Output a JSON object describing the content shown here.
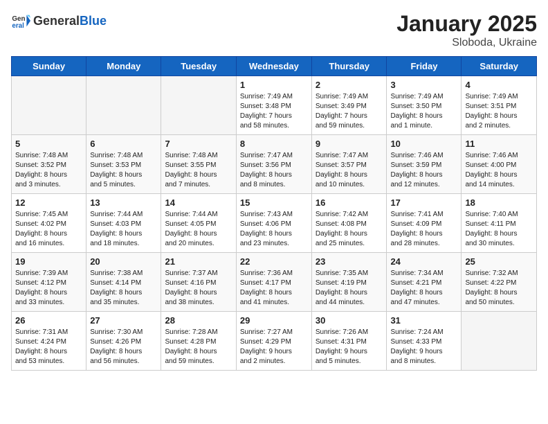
{
  "header": {
    "logo_general": "General",
    "logo_blue": "Blue",
    "title": "January 2025",
    "subtitle": "Sloboda, Ukraine"
  },
  "weekdays": [
    "Sunday",
    "Monday",
    "Tuesday",
    "Wednesday",
    "Thursday",
    "Friday",
    "Saturday"
  ],
  "weeks": [
    [
      {
        "day": "",
        "info": ""
      },
      {
        "day": "",
        "info": ""
      },
      {
        "day": "",
        "info": ""
      },
      {
        "day": "1",
        "info": "Sunrise: 7:49 AM\nSunset: 3:48 PM\nDaylight: 7 hours\nand 58 minutes."
      },
      {
        "day": "2",
        "info": "Sunrise: 7:49 AM\nSunset: 3:49 PM\nDaylight: 7 hours\nand 59 minutes."
      },
      {
        "day": "3",
        "info": "Sunrise: 7:49 AM\nSunset: 3:50 PM\nDaylight: 8 hours\nand 1 minute."
      },
      {
        "day": "4",
        "info": "Sunrise: 7:49 AM\nSunset: 3:51 PM\nDaylight: 8 hours\nand 2 minutes."
      }
    ],
    [
      {
        "day": "5",
        "info": "Sunrise: 7:48 AM\nSunset: 3:52 PM\nDaylight: 8 hours\nand 3 minutes."
      },
      {
        "day": "6",
        "info": "Sunrise: 7:48 AM\nSunset: 3:53 PM\nDaylight: 8 hours\nand 5 minutes."
      },
      {
        "day": "7",
        "info": "Sunrise: 7:48 AM\nSunset: 3:55 PM\nDaylight: 8 hours\nand 7 minutes."
      },
      {
        "day": "8",
        "info": "Sunrise: 7:47 AM\nSunset: 3:56 PM\nDaylight: 8 hours\nand 8 minutes."
      },
      {
        "day": "9",
        "info": "Sunrise: 7:47 AM\nSunset: 3:57 PM\nDaylight: 8 hours\nand 10 minutes."
      },
      {
        "day": "10",
        "info": "Sunrise: 7:46 AM\nSunset: 3:59 PM\nDaylight: 8 hours\nand 12 minutes."
      },
      {
        "day": "11",
        "info": "Sunrise: 7:46 AM\nSunset: 4:00 PM\nDaylight: 8 hours\nand 14 minutes."
      }
    ],
    [
      {
        "day": "12",
        "info": "Sunrise: 7:45 AM\nSunset: 4:02 PM\nDaylight: 8 hours\nand 16 minutes."
      },
      {
        "day": "13",
        "info": "Sunrise: 7:44 AM\nSunset: 4:03 PM\nDaylight: 8 hours\nand 18 minutes."
      },
      {
        "day": "14",
        "info": "Sunrise: 7:44 AM\nSunset: 4:05 PM\nDaylight: 8 hours\nand 20 minutes."
      },
      {
        "day": "15",
        "info": "Sunrise: 7:43 AM\nSunset: 4:06 PM\nDaylight: 8 hours\nand 23 minutes."
      },
      {
        "day": "16",
        "info": "Sunrise: 7:42 AM\nSunset: 4:08 PM\nDaylight: 8 hours\nand 25 minutes."
      },
      {
        "day": "17",
        "info": "Sunrise: 7:41 AM\nSunset: 4:09 PM\nDaylight: 8 hours\nand 28 minutes."
      },
      {
        "day": "18",
        "info": "Sunrise: 7:40 AM\nSunset: 4:11 PM\nDaylight: 8 hours\nand 30 minutes."
      }
    ],
    [
      {
        "day": "19",
        "info": "Sunrise: 7:39 AM\nSunset: 4:12 PM\nDaylight: 8 hours\nand 33 minutes."
      },
      {
        "day": "20",
        "info": "Sunrise: 7:38 AM\nSunset: 4:14 PM\nDaylight: 8 hours\nand 35 minutes."
      },
      {
        "day": "21",
        "info": "Sunrise: 7:37 AM\nSunset: 4:16 PM\nDaylight: 8 hours\nand 38 minutes."
      },
      {
        "day": "22",
        "info": "Sunrise: 7:36 AM\nSunset: 4:17 PM\nDaylight: 8 hours\nand 41 minutes."
      },
      {
        "day": "23",
        "info": "Sunrise: 7:35 AM\nSunset: 4:19 PM\nDaylight: 8 hours\nand 44 minutes."
      },
      {
        "day": "24",
        "info": "Sunrise: 7:34 AM\nSunset: 4:21 PM\nDaylight: 8 hours\nand 47 minutes."
      },
      {
        "day": "25",
        "info": "Sunrise: 7:32 AM\nSunset: 4:22 PM\nDaylight: 8 hours\nand 50 minutes."
      }
    ],
    [
      {
        "day": "26",
        "info": "Sunrise: 7:31 AM\nSunset: 4:24 PM\nDaylight: 8 hours\nand 53 minutes."
      },
      {
        "day": "27",
        "info": "Sunrise: 7:30 AM\nSunset: 4:26 PM\nDaylight: 8 hours\nand 56 minutes."
      },
      {
        "day": "28",
        "info": "Sunrise: 7:28 AM\nSunset: 4:28 PM\nDaylight: 8 hours\nand 59 minutes."
      },
      {
        "day": "29",
        "info": "Sunrise: 7:27 AM\nSunset: 4:29 PM\nDaylight: 9 hours\nand 2 minutes."
      },
      {
        "day": "30",
        "info": "Sunrise: 7:26 AM\nSunset: 4:31 PM\nDaylight: 9 hours\nand 5 minutes."
      },
      {
        "day": "31",
        "info": "Sunrise: 7:24 AM\nSunset: 4:33 PM\nDaylight: 9 hours\nand 8 minutes."
      },
      {
        "day": "",
        "info": ""
      }
    ]
  ]
}
